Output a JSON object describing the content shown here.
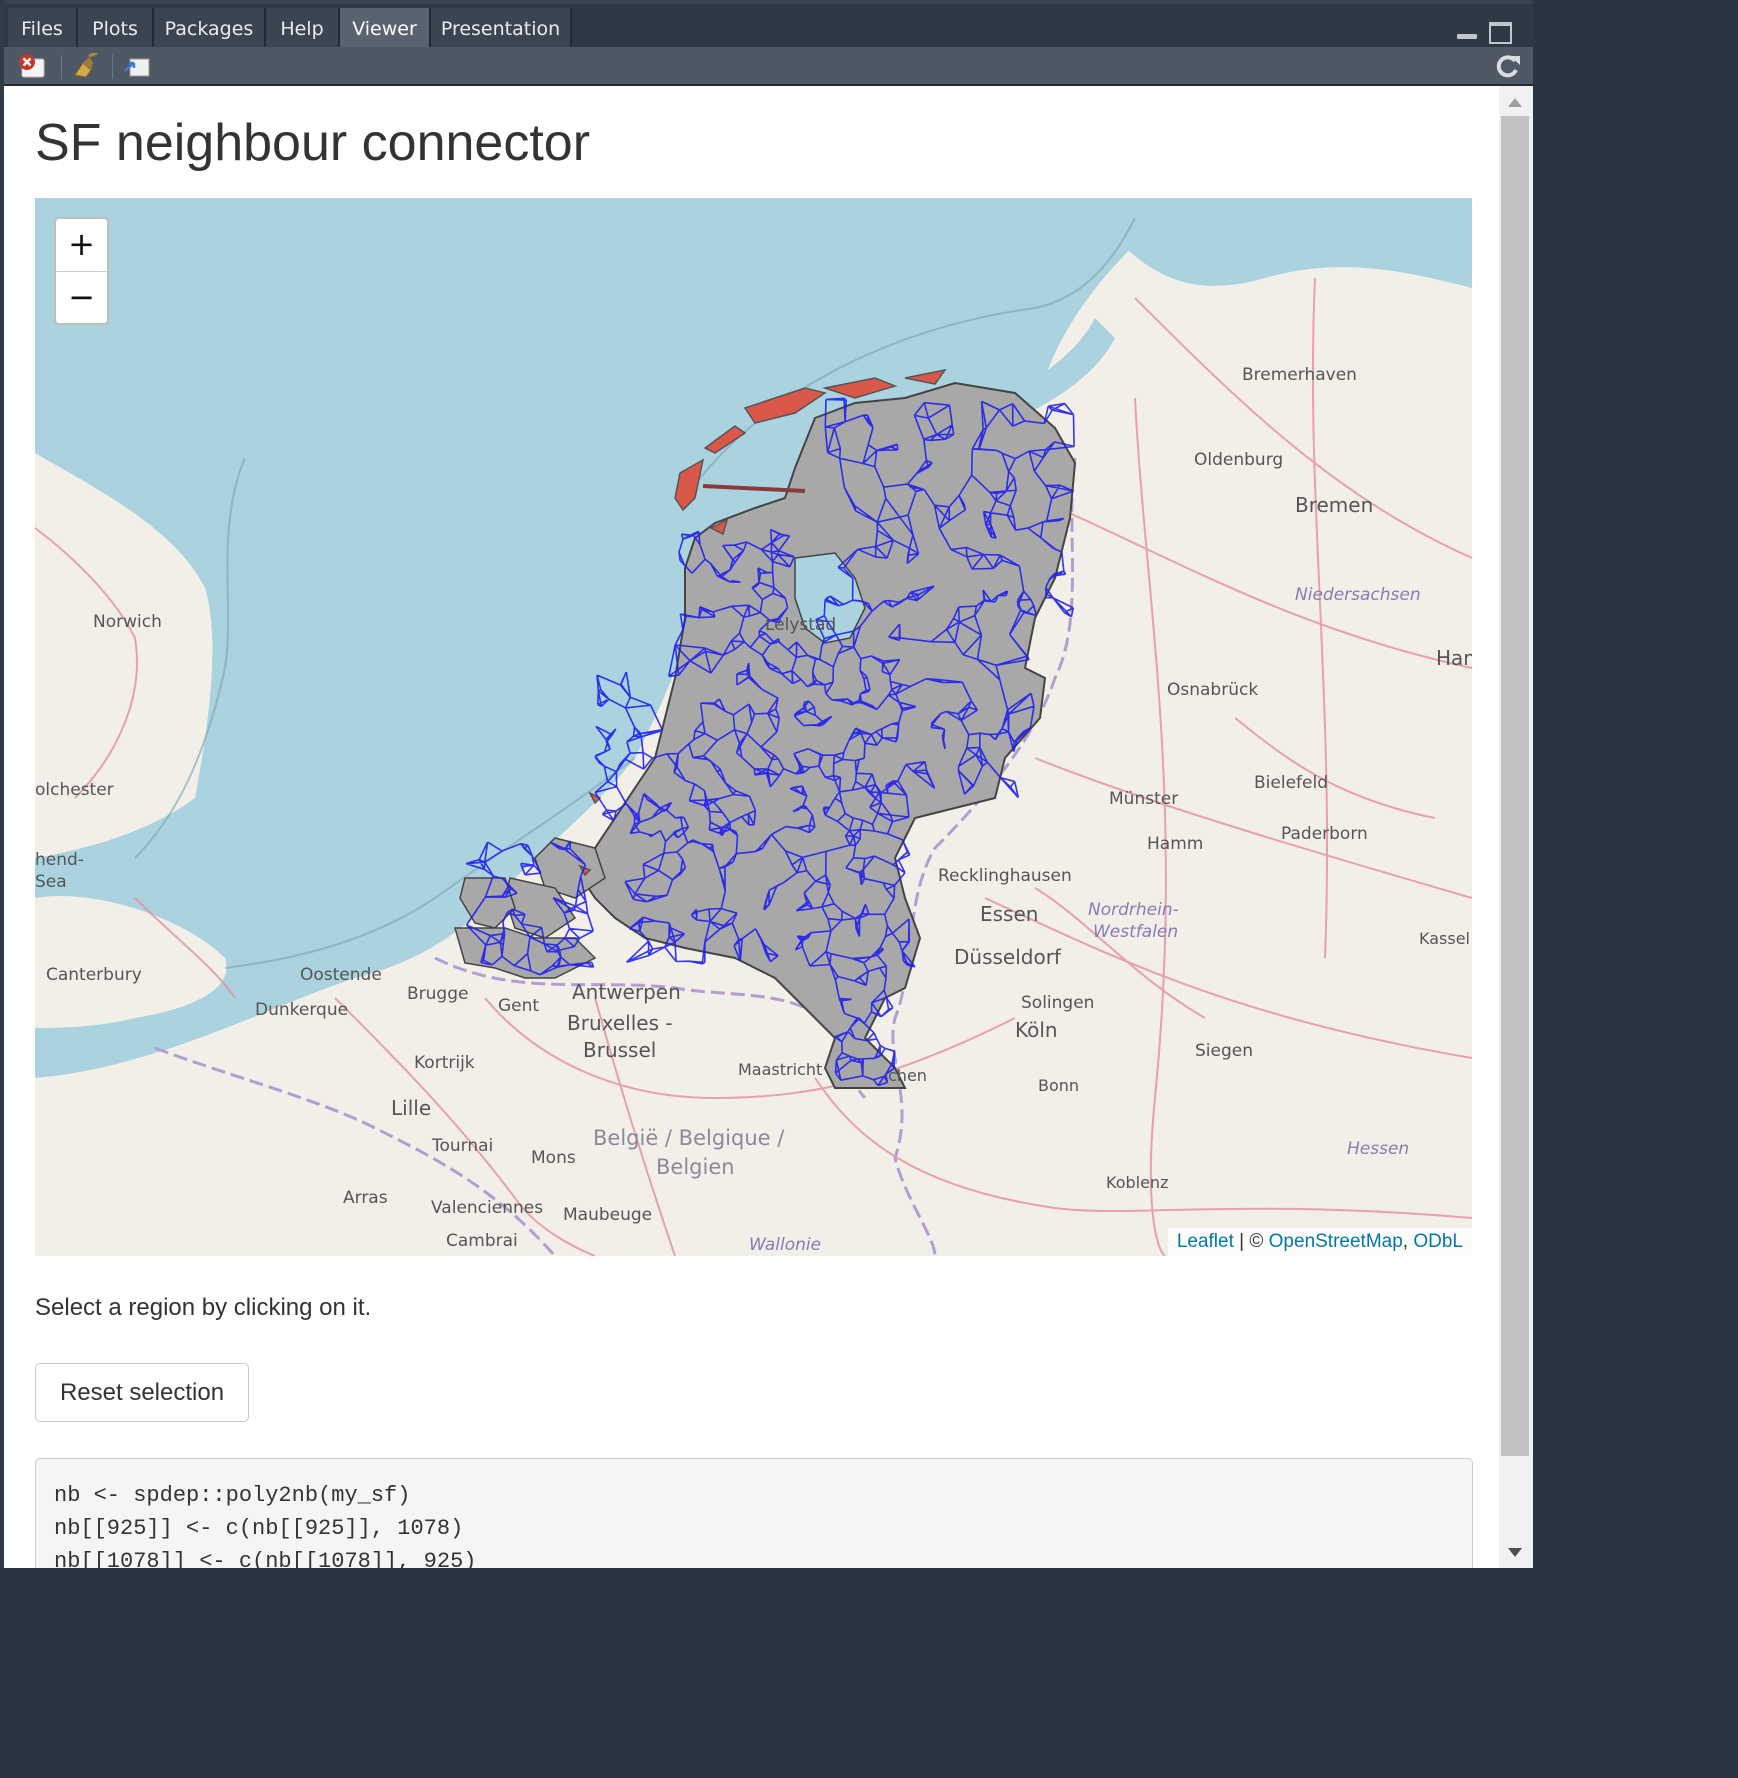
{
  "tabs": [
    {
      "label": "Files",
      "active": false
    },
    {
      "label": "Plots",
      "active": false
    },
    {
      "label": "Packages",
      "active": false
    },
    {
      "label": "Help",
      "active": false
    },
    {
      "label": "Viewer",
      "active": true
    },
    {
      "label": "Presentation",
      "active": false
    }
  ],
  "toolbar": {
    "icons": [
      "close-viewer-icon",
      "clear-broom-icon",
      "export-icon",
      "refresh-icon"
    ]
  },
  "page": {
    "title": "SF neighbour connector",
    "instructions": "Select a region by clicking on it.",
    "reset_button": "Reset selection"
  },
  "map": {
    "zoom_in_label": "+",
    "zoom_out_label": "−",
    "attribution": {
      "leaflet": "Leaflet",
      "separator": " | © ",
      "osm": "OpenStreetMap",
      "comma": ", ",
      "odbl": "ODbL"
    },
    "place_labels": [
      {
        "text": "Bremerhaven",
        "kind": "city"
      },
      {
        "text": "Oldenburg",
        "kind": "city"
      },
      {
        "text": "Bremen",
        "kind": "big"
      },
      {
        "text": "Niedersachsen",
        "kind": "region"
      },
      {
        "text": "Han",
        "kind": "big"
      },
      {
        "text": "Norwich",
        "kind": "city"
      },
      {
        "text": "Lelystad",
        "kind": "city"
      },
      {
        "text": "Osnabrück",
        "kind": "city"
      },
      {
        "text": "Bielefeld",
        "kind": "city"
      },
      {
        "text": "Münster",
        "kind": "city"
      },
      {
        "text": "Hamm",
        "kind": "city"
      },
      {
        "text": "Paderborn",
        "kind": "city"
      },
      {
        "text": "olchester",
        "kind": "city"
      },
      {
        "text": "hend-",
        "kind": "city"
      },
      {
        "text": "Sea",
        "kind": "city"
      },
      {
        "text": "Recklinghausen",
        "kind": "city"
      },
      {
        "text": "Essen",
        "kind": "big"
      },
      {
        "text": "Nordrhein-",
        "kind": "region"
      },
      {
        "text": "Westfalen",
        "kind": "region"
      },
      {
        "text": "Kassel",
        "kind": "city"
      },
      {
        "text": "Canterbury",
        "kind": "city"
      },
      {
        "text": "Oostende",
        "kind": "city"
      },
      {
        "text": "Düsseldorf",
        "kind": "big"
      },
      {
        "text": "Dunkerque",
        "kind": "city"
      },
      {
        "text": "Brugge",
        "kind": "city"
      },
      {
        "text": "Gent",
        "kind": "city"
      },
      {
        "text": "Antwerpen",
        "kind": "big"
      },
      {
        "text": "Solingen",
        "kind": "city"
      },
      {
        "text": "Bruxelles -",
        "kind": "big"
      },
      {
        "text": "Brussel",
        "kind": "big"
      },
      {
        "text": "Köln",
        "kind": "big"
      },
      {
        "text": "Kortrijk",
        "kind": "city"
      },
      {
        "text": "Maastricht",
        "kind": "city"
      },
      {
        "text": "chen",
        "kind": "city"
      },
      {
        "text": "Siegen",
        "kind": "city"
      },
      {
        "text": "Lille",
        "kind": "big"
      },
      {
        "text": "Bonn",
        "kind": "city"
      },
      {
        "text": "Tournai",
        "kind": "city"
      },
      {
        "text": "België / Belgique /",
        "kind": "country"
      },
      {
        "text": "Belgien",
        "kind": "country"
      },
      {
        "text": "Mons",
        "kind": "city"
      },
      {
        "text": "Hessen",
        "kind": "region"
      },
      {
        "text": "Arras",
        "kind": "city"
      },
      {
        "text": "Valenciennes",
        "kind": "city"
      },
      {
        "text": "Maubeuge",
        "kind": "city"
      },
      {
        "text": "Koblenz",
        "kind": "city"
      },
      {
        "text": "Cambrai",
        "kind": "city"
      },
      {
        "text": "Wallonie",
        "kind": "region"
      }
    ],
    "colors": {
      "sea": "#aad3df",
      "land": "#f2efe9",
      "region_fill": "#a8a8a8",
      "region_border": "#444444",
      "neighbour_links": "#1f1ff0",
      "selected_region": "#d9584a"
    }
  },
  "code": [
    "nb <- spdep::poly2nb(my_sf)",
    "nb[[925]] <- c(nb[[925]], 1078)",
    "nb[[1078]] <- c(nb[[1078]], 925)"
  ]
}
